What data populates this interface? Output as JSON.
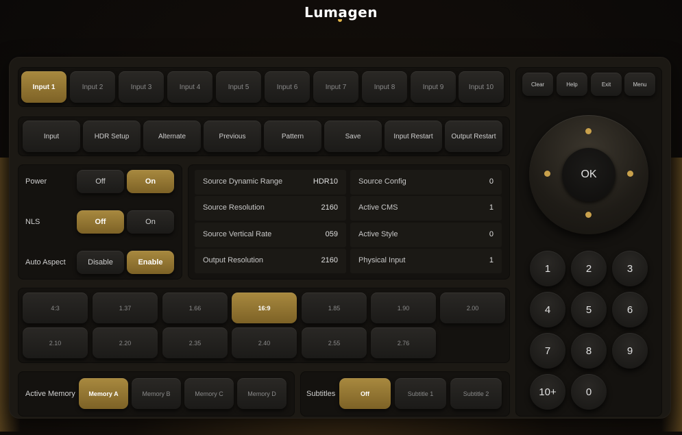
{
  "brand": {
    "logo_text": "Lumagen"
  },
  "inputs": [
    "Input 1",
    "Input 2",
    "Input 3",
    "Input 4",
    "Input 5",
    "Input 6",
    "Input 7",
    "Input 8",
    "Input 9",
    "Input 10"
  ],
  "selected_input": "Input 1",
  "functions": [
    "Input",
    "HDR Setup",
    "Alternate",
    "Previous",
    "Pattern",
    "Save",
    "Input Restart",
    "Output Restart"
  ],
  "system_buttons": [
    "Clear",
    "Help",
    "Exit",
    "Menu"
  ],
  "power": {
    "label": "Power",
    "off": "Off",
    "on": "On",
    "selected": "On"
  },
  "nls": {
    "label": "NLS",
    "off": "Off",
    "on": "On",
    "selected": "Off"
  },
  "auto_aspect": {
    "label": "Auto Aspect",
    "disable": "Disable",
    "enable": "Enable",
    "selected": "Enable"
  },
  "status": [
    {
      "key": "Source Dynamic Range",
      "value": "HDR10"
    },
    {
      "key": "Source Config",
      "value": "0"
    },
    {
      "key": "Source Resolution",
      "value": "2160"
    },
    {
      "key": "Active CMS",
      "value": "1"
    },
    {
      "key": "Source Vertical Rate",
      "value": "059"
    },
    {
      "key": "Active Style",
      "value": "0"
    },
    {
      "key": "Output Resolution",
      "value": "2160"
    },
    {
      "key": "Physical Input",
      "value": "1"
    }
  ],
  "aspects": [
    "4:3",
    "1.37",
    "1.66",
    "16:9",
    "1.85",
    "1.90",
    "2.00",
    "2.10",
    "2.20",
    "2.35",
    "2.40",
    "2.55",
    "2.76"
  ],
  "selected_aspect": "16:9",
  "active_memory": {
    "label": "Active Memory",
    "options": [
      "Memory A",
      "Memory B",
      "Memory C",
      "Memory D"
    ],
    "selected": "Memory A"
  },
  "subtitles": {
    "label": "Subtitles",
    "options": [
      "Off",
      "Subtitle 1",
      "Subtitle 2"
    ],
    "selected": "Off"
  },
  "dpad": {
    "ok": "OK"
  },
  "keypad": [
    "1",
    "2",
    "3",
    "4",
    "5",
    "6",
    "7",
    "8",
    "9",
    "10+",
    "0"
  ],
  "colors": {
    "gold": "#a8893f",
    "background": "#0b0908",
    "panel": "#1c1914"
  }
}
